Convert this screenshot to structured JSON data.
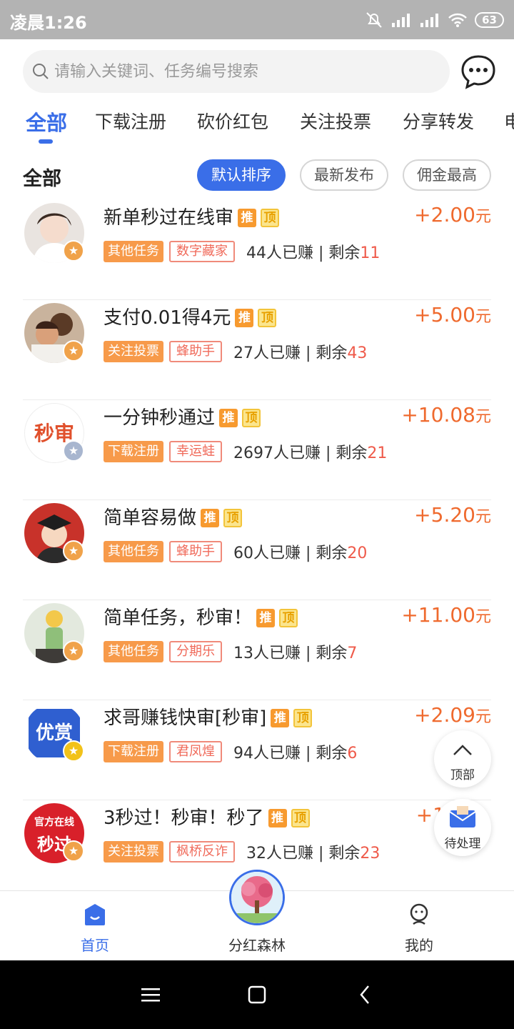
{
  "status_bar": {
    "time": "凌晨1:26",
    "battery": "63"
  },
  "search": {
    "placeholder": "请输入关键词、任务编号搜索"
  },
  "tabs": [
    {
      "label": "全部",
      "active": true
    },
    {
      "label": "下载注册"
    },
    {
      "label": "砍价红包"
    },
    {
      "label": "关注投票"
    },
    {
      "label": "分享转发"
    },
    {
      "label": "电"
    }
  ],
  "section": {
    "title": "全部"
  },
  "sort": [
    {
      "label": "默认排序",
      "active": true
    },
    {
      "label": "最新发布"
    },
    {
      "label": "佣金最高"
    }
  ],
  "labels": {
    "tui": "推",
    "ding": "顶",
    "unit": "元",
    "separator": " | 剩余",
    "earned_suffix": "人已赚"
  },
  "tasks": [
    {
      "title": "新单秒过在线审",
      "reward": "+2.00",
      "category": "其他任务",
      "source": "数字藏家",
      "earned": "44",
      "remaining": "11"
    },
    {
      "title": "支付0.01得4元",
      "reward": "+5.00",
      "category": "关注投票",
      "source": "蜂助手",
      "earned": "27",
      "remaining": "43"
    },
    {
      "title": "一分钟秒通过",
      "reward": "+10.08",
      "category": "下载注册",
      "source": "幸运蛙",
      "earned": "2697",
      "remaining": "21",
      "avatar_text": "秒审"
    },
    {
      "title": "简单容易做",
      "reward": "+5.20",
      "category": "其他任务",
      "source": "蜂助手",
      "earned": "60",
      "remaining": "20"
    },
    {
      "title": "简单任务，秒审！",
      "reward": "+11.00",
      "category": "其他任务",
      "source": "分期乐",
      "earned": "13",
      "remaining": "7"
    },
    {
      "title": "求哥赚钱快审[秒审]",
      "reward": "+2.09",
      "category": "下载注册",
      "source": "君凤煌",
      "earned": "94",
      "remaining": "6",
      "avatar_text": "优赏"
    },
    {
      "title": "3秒过！秒审！秒了",
      "reward": "+1",
      "category": "关注投票",
      "source": "枫桥反诈",
      "earned": "32",
      "remaining": "23",
      "avatar_text_top": "官方在线",
      "avatar_text_bottom": "秒过"
    }
  ],
  "float_buttons": {
    "top": "顶部",
    "pending": "待处理"
  },
  "bottom_nav": {
    "home": "首页",
    "forest": "分红森林",
    "mine": "我的"
  },
  "colors": {
    "accent": "#3a6ee8",
    "reward": "#ef6a2e",
    "category": "#f79a4a",
    "source_border": "#f08a7a"
  }
}
